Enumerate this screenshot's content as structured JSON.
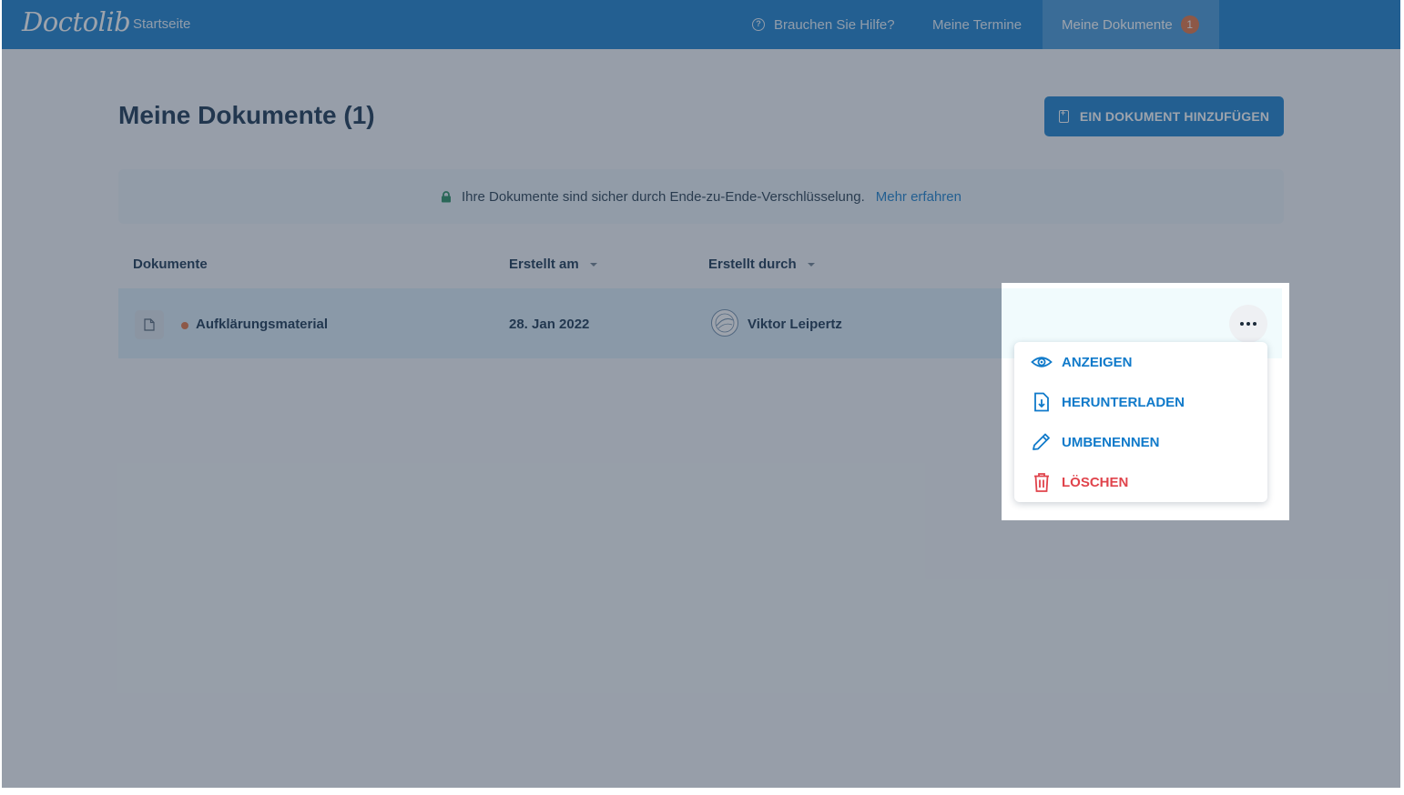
{
  "topbar": {
    "logo": "Doctolib",
    "home": "Startseite",
    "help": "Brauchen Sie Hilfe?",
    "help_icon": "?",
    "appointments": "Meine Termine",
    "documents": "Meine Dokumente",
    "documents_badge": "1"
  },
  "page": {
    "title": "Meine Dokumente (1)",
    "add_button": "EIN DOKUMENT HINZUFÜGEN"
  },
  "banner": {
    "text": "Ihre Dokumente sind sicher durch Ende-zu-Ende-Verschlüsselung.",
    "link": "Mehr erfahren"
  },
  "table": {
    "columns": [
      "Dokumente",
      "Erstellt am",
      "Erstellt durch"
    ],
    "rows": [
      {
        "name": "Aufklärungsmaterial",
        "date": "28. Jan 2022",
        "author": "Viktor Leipertz"
      }
    ]
  },
  "menu": {
    "items": [
      {
        "label": "ANZEIGEN",
        "icon": "eye-icon"
      },
      {
        "label": "HERUNTERLADEN",
        "icon": "download-file-icon"
      },
      {
        "label": "UMBENENNEN",
        "icon": "pencil-icon"
      },
      {
        "label": "LÖSCHEN",
        "icon": "trash-icon"
      }
    ]
  },
  "colors": {
    "primary": "#107aca",
    "danger": "#e0444c",
    "badge": "#e06c3a",
    "title": "#0e2c4a"
  }
}
